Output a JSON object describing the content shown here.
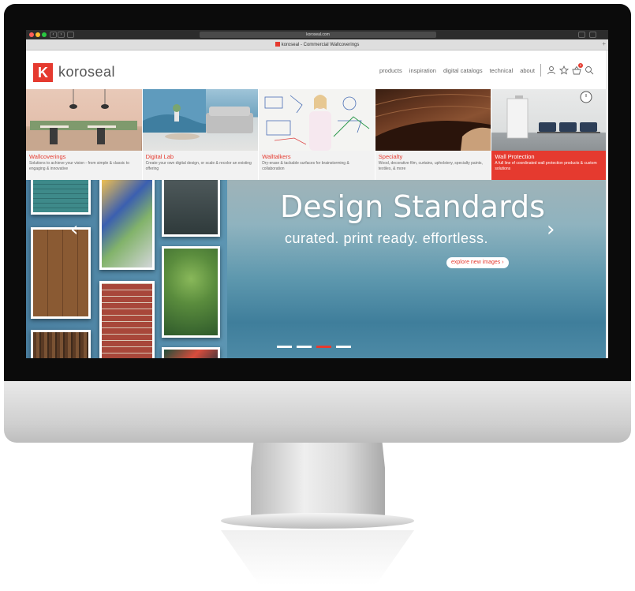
{
  "browser": {
    "url": "koroseal.com",
    "tab_title": "koroseal - Commercial Wallcoverings",
    "new_tab_glyph": "+"
  },
  "header": {
    "logo_mark": "K",
    "logo_text": "koroseal",
    "nav": [
      "products",
      "inspiration",
      "digital catalogs",
      "technical",
      "about"
    ],
    "cart_count": "0"
  },
  "categories": [
    {
      "title": "Wallcoverings",
      "desc": "Solutions to achieve your vision - from simple & classic to engaging & innovative",
      "highlight": false
    },
    {
      "title": "Digital Lab",
      "desc": "Create your own digital design, or scale & recolor an existing offering",
      "highlight": false
    },
    {
      "title": "Walltalkers",
      "desc": "Dry-erase & tackable surfaces for brainstorming & collaboration",
      "highlight": false
    },
    {
      "title": "Specialty",
      "desc": "Wood, decorative film, curtains, upholstery, specialty paints, textiles, & more",
      "highlight": false
    },
    {
      "title": "Wall Protection",
      "desc": "A full line of coordinated wall protection products & custom solutions",
      "highlight": true
    }
  ],
  "hero": {
    "title": "Design Standards",
    "subtitle": "curated. print ready. effortless.",
    "cta": "explore new images ›",
    "prev_glyph": "‹",
    "next_glyph": "›",
    "slide_count": 4,
    "active_slide": 3
  },
  "colors": {
    "accent": "#e53a2f"
  }
}
